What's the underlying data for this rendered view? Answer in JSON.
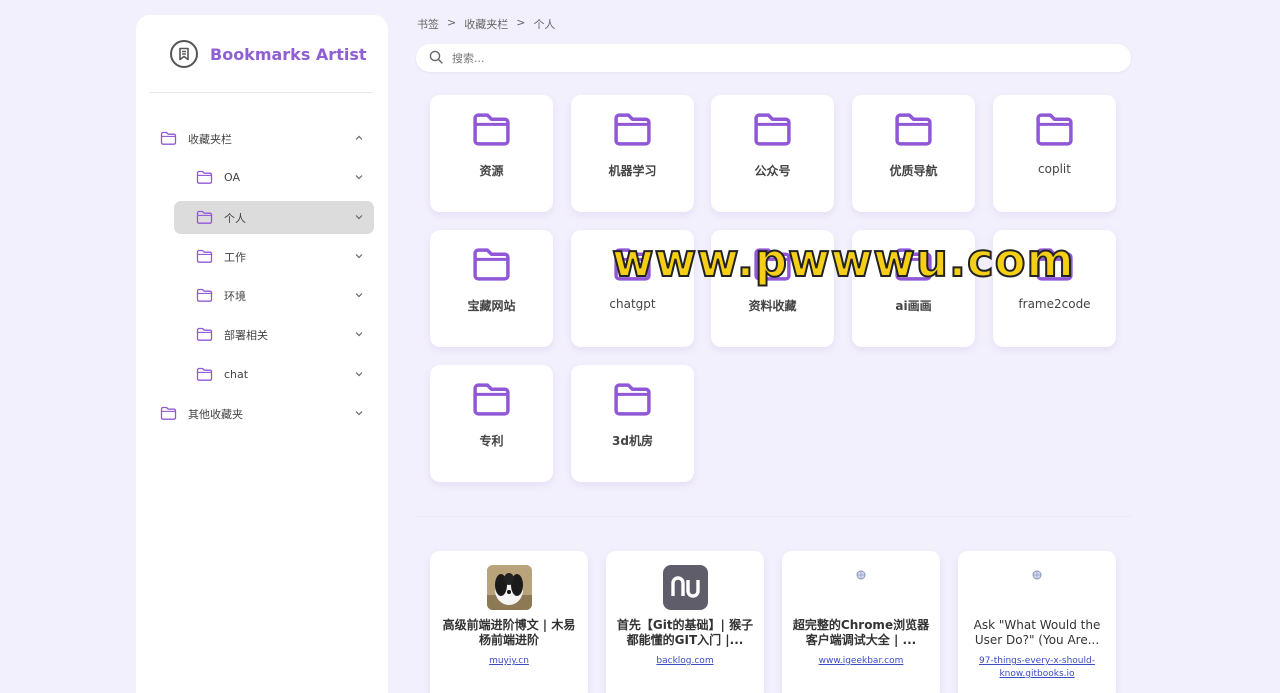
{
  "colors": {
    "accent": "#8f5fd3",
    "folder": "#9058d6",
    "background": "#f3f0fd",
    "active_item": "#dcdcdc",
    "link": "#3b4cc4"
  },
  "app": {
    "title": "Bookmarks Artist",
    "logo_icon": "bookmark-icon"
  },
  "breadcrumb": [
    "书签",
    "收藏夹栏",
    "个人"
  ],
  "breadcrumb_separator": ">",
  "search": {
    "placeholder": "搜索..."
  },
  "sidebar": {
    "items": [
      {
        "label": "收藏夹栏",
        "level": 0,
        "expanded": true,
        "active": false
      },
      {
        "label": "OA",
        "level": 1,
        "expanded": false,
        "active": false
      },
      {
        "label": "个人",
        "level": 1,
        "expanded": false,
        "active": true
      },
      {
        "label": "工作",
        "level": 1,
        "expanded": false,
        "active": false
      },
      {
        "label": "环境",
        "level": 1,
        "expanded": false,
        "active": false
      },
      {
        "label": "部署相关",
        "level": 1,
        "expanded": false,
        "active": false
      },
      {
        "label": "chat",
        "level": 1,
        "expanded": false,
        "active": false
      },
      {
        "label": "其他收藏夹",
        "level": 0,
        "expanded": false,
        "active": false
      }
    ]
  },
  "folders": [
    "资源",
    "机器学习",
    "公众号",
    "优质导航",
    "coplit",
    "宝藏网站",
    "chatgpt",
    "资料收藏",
    "ai画画",
    "frame2code",
    "专利",
    "3d机房"
  ],
  "sites": [
    {
      "title": "高级前端进阶博文 | 木易杨前端进阶",
      "link": "muyiy.cn",
      "icon": "dog-photo"
    },
    {
      "title": "首先【Git的基础】| 猴子都能懂的GIT入门 |...",
      "link": "backlog.com",
      "icon": "nu-logo"
    },
    {
      "title": "超完整的Chrome浏览器客户端调试大全 | ...",
      "link": "www.igeekbar.com",
      "icon": "globe-icon"
    },
    {
      "title": "Ask \"What Would the User Do?\" (You Are...",
      "link": "97-things-every-x-should-know.gitbooks.io",
      "icon": "globe-icon"
    }
  ],
  "watermark": "www.pwwwu.com"
}
